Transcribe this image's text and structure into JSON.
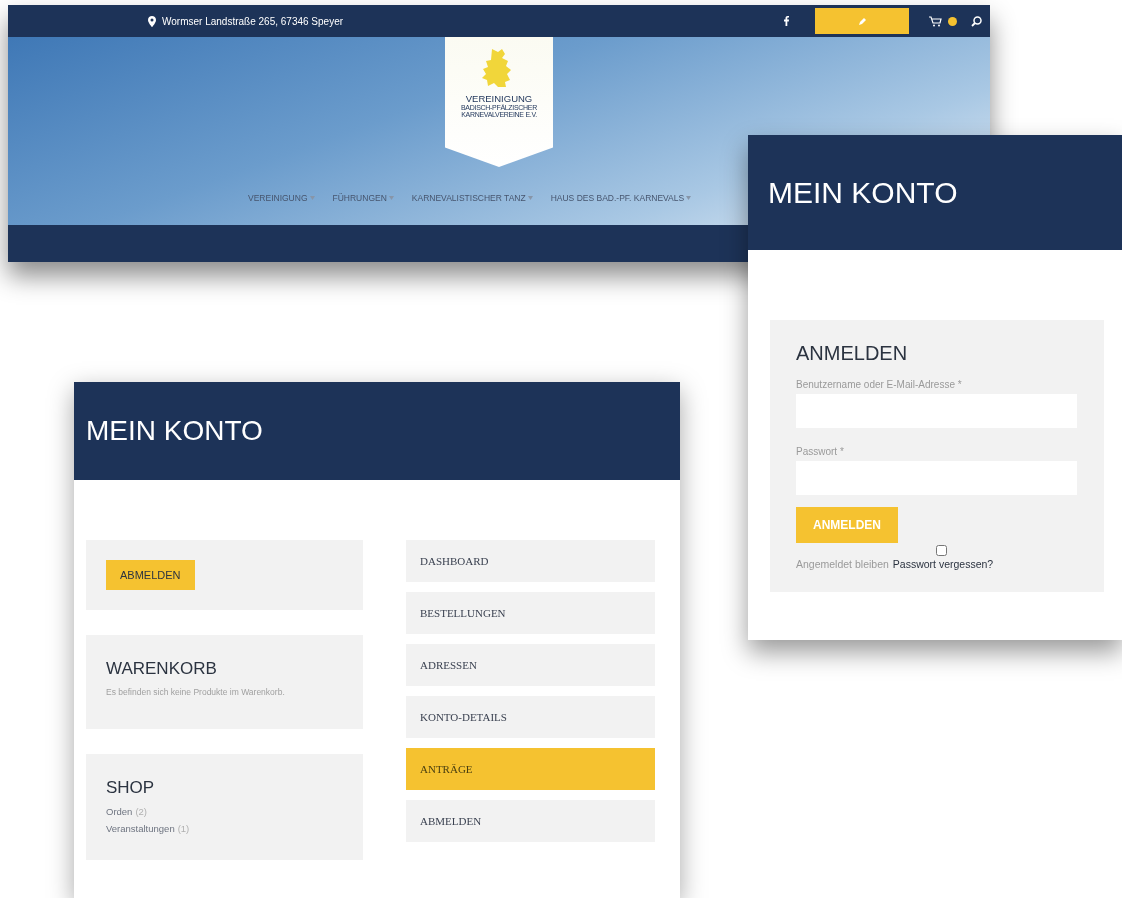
{
  "site": {
    "address": "Wormser Landstraße 265, 67346 Speyer",
    "logo_lines": [
      "VEREINIGUNG",
      "BADISCH-PFÄLZISCHER",
      "KARNEVALVEREINE E.V."
    ],
    "nav": [
      {
        "label": "VEREINIGUNG"
      },
      {
        "label": "FÜHRUNGEN"
      },
      {
        "label": "KARNEVALISTISCHER TANZ"
      },
      {
        "label": "HAUS DES BAD.-PF. KARNEVALS"
      }
    ]
  },
  "login": {
    "title": "MEIN KONTO",
    "heading": "ANMELDEN",
    "fields": [
      {
        "label": "Benutzername oder E-Mail-Adresse *"
      },
      {
        "label": "Passwort *"
      }
    ],
    "button": "ANMELDEN",
    "remember": {
      "label": "Angemeldet bleiben",
      "checked": false
    },
    "forgot": "Passwort vergessen?"
  },
  "account": {
    "title": "MEIN KONTO",
    "logout_button": "ABMELDEN",
    "cart": {
      "heading": "WARENKORB",
      "text": "Es befinden sich keine Produkte im Warenkorb."
    },
    "shop": {
      "heading": "SHOP",
      "links": [
        {
          "label": "Orden",
          "count": "(2)"
        },
        {
          "label": "Veranstaltungen",
          "count": "(1)"
        }
      ]
    },
    "menu": [
      {
        "label": "DASHBOARD",
        "selected": false
      },
      {
        "label": "BESTELLUNGEN",
        "selected": false
      },
      {
        "label": "ADRESSEN",
        "selected": false
      },
      {
        "label": "KONTO-DETAILS",
        "selected": false
      },
      {
        "label": "ANTRÄGE",
        "selected": true
      },
      {
        "label": "ABMELDEN",
        "selected": false
      }
    ]
  }
}
